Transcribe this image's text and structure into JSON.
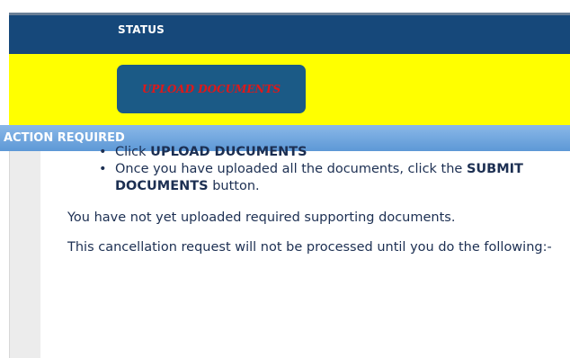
{
  "status_bar": {
    "label": "STATUS"
  },
  "upload_panel": {
    "button_label": "UPLOAD DOCUMENTS"
  },
  "action_bar": {
    "label": "ACTION REQUIRED"
  },
  "message": {
    "line1": "You have not yet uploaded required supporting documents.",
    "line2": "This cancellation request will not be processed until you do the following:-",
    "steps": [
      {
        "pre": "Click ",
        "bold": "UPLOAD DUCUMENTS",
        "post": ""
      },
      {
        "pre": "Once you have uploaded all the documents, click the ",
        "bold": "SUBMIT DOCUMENTS",
        "post": " button."
      }
    ]
  },
  "colors": {
    "status_bar": "#16487a",
    "panel_yellow": "#ffff00",
    "button_blue": "#1b5a86",
    "button_text": "#e01818",
    "action_bar": "#5d98d6",
    "body_text": "#1c2f52"
  }
}
